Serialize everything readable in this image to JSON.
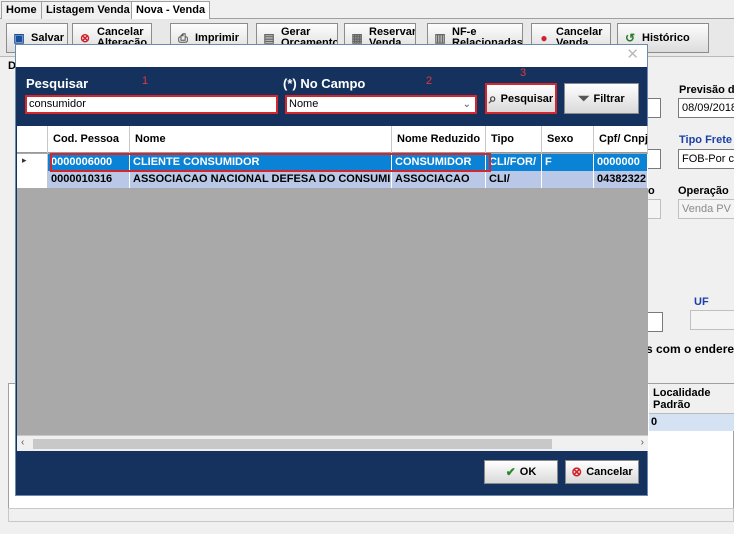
{
  "tabs": [
    {
      "label": "Home"
    },
    {
      "label": "Listagem Venda"
    },
    {
      "label": "Nova - Venda"
    }
  ],
  "toolbar": {
    "save_label": "Salvar",
    "cancel_alter_label": "Cancelar Alteração",
    "print_label": "Imprimir",
    "budget_label": "Gerar Orçamento",
    "reserve_label": "Reservar Venda",
    "nfe_label": "NF-e Relacionadas",
    "cancel_sale_label": "Cancelar Venda",
    "history_label": "Histórico"
  },
  "background": {
    "section_letter": "D",
    "previsao_label": "Previsão de",
    "previsao_value": "08/09/2018",
    "tipo_frete_label": "Tipo Frete",
    "tipo_frete_value": "FOB-Por co",
    "operacao_label": "Operação",
    "operacao_value": "Venda PV",
    "operacao_prefix": "o",
    "uf_label": "UF",
    "endereco_text": "s com o endereço",
    "localidade_header": "Localidade Padrão",
    "localidade_value": "0"
  },
  "dialog": {
    "close_glyph": "✕",
    "search_label": "Pesquisar",
    "search_value": "consumidor",
    "field_label": "(*) No Campo",
    "field_value": "Nome",
    "annotation_1": "1",
    "annotation_2": "2",
    "annotation_3": "3",
    "search_button": "Pesquisar",
    "filter_button": "Filtrar",
    "ok_button": "OK",
    "cancel_button": "Cancelar",
    "columns": [
      {
        "label": "Cod. Pessoa"
      },
      {
        "label": "Nome"
      },
      {
        "label": "Nome Reduzido"
      },
      {
        "label": "Tipo"
      },
      {
        "label": "Sexo"
      },
      {
        "label": "Cpf/ Cnpj"
      }
    ],
    "rows": [
      {
        "cod": "0000006000",
        "nome": "CLIENTE CONSUMIDOR",
        "reduzido": "CONSUMIDOR",
        "tipo": "CLI/FOR/",
        "sexo": "F",
        "cpf": "0000000",
        "selected": true
      },
      {
        "cod": "0000010316",
        "nome": "ASSOCIACAO NACIONAL DEFESA DO CONSUMIDOR",
        "reduzido": "ASSOCIACAO",
        "tipo": "CLI/",
        "sexo": "",
        "cpf": "04382322",
        "selected": false
      }
    ]
  },
  "colors": {
    "dialog_bg": "#15325f",
    "highlight": "#d6262c",
    "selected_row": "#0a82d6",
    "alt_row": "#b8c8e6"
  }
}
